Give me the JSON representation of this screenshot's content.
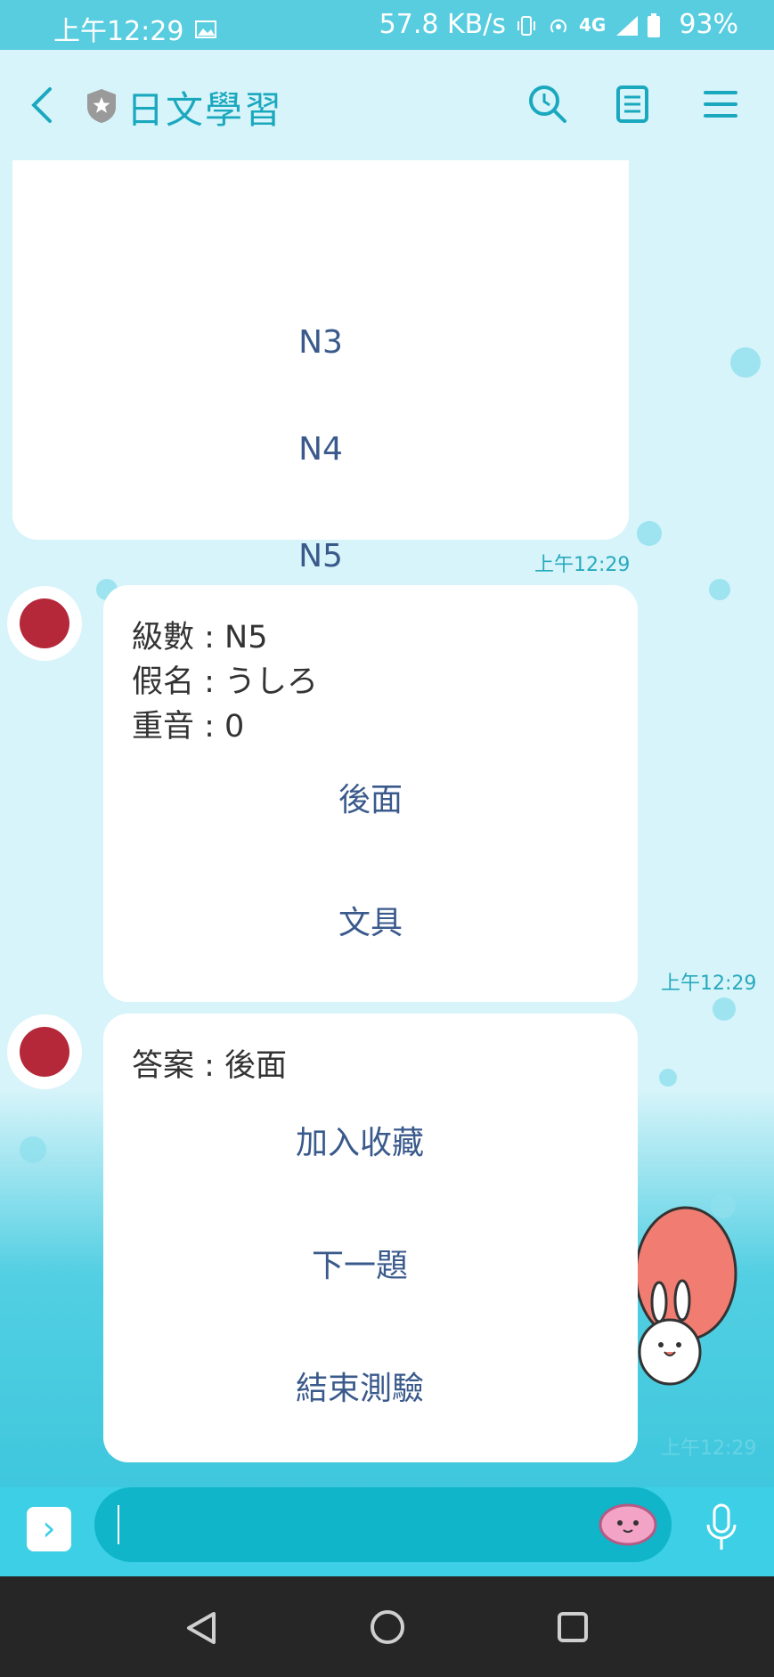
{
  "status_bar": {
    "time": "上午12:29",
    "speed": "57.8 KB/s",
    "network": "4G",
    "battery": "93%"
  },
  "header": {
    "title": "日文學習"
  },
  "messages": {
    "level_options": [
      "N3",
      "N4",
      "N5"
    ],
    "level_time": "上午12:29",
    "question": {
      "line1": "級數 : N5",
      "line2": "假名 :  うしろ",
      "line3": "重音 : 0",
      "options": [
        "後面",
        "文具"
      ],
      "time": "上午12:29"
    },
    "answer": {
      "line": "答案 :  後面",
      "options": [
        "加入收藏",
        "下一題",
        "結束測驗"
      ],
      "time": "上午12:29"
    }
  },
  "input_bar": {
    "placeholder": ""
  },
  "colors": {
    "status_bar": "#58cde0",
    "chat_background": "#d7f4fa",
    "accent": "#1aa8bf",
    "option_text": "#3a5a8c",
    "avatar_sun": "#b4283a"
  }
}
